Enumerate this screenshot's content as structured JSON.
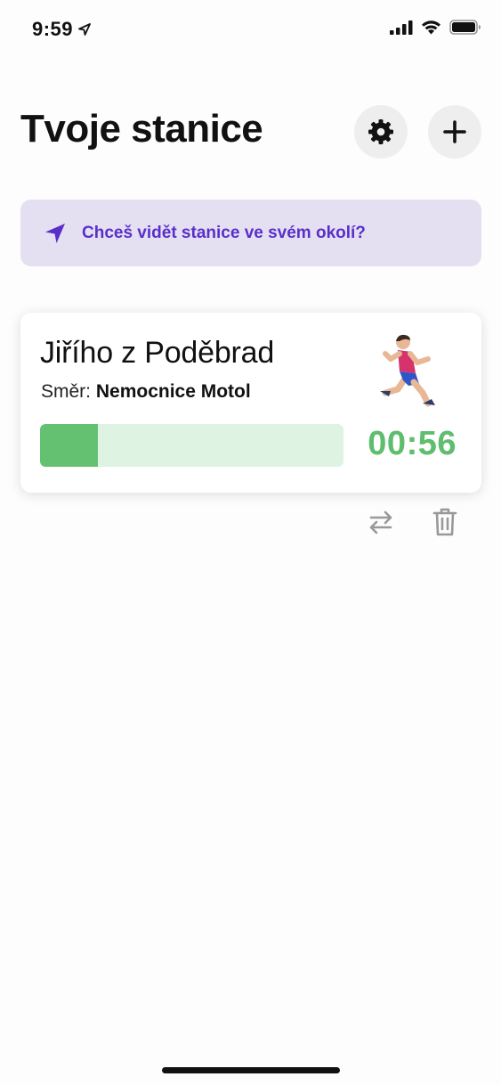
{
  "status_bar": {
    "time": "9:59",
    "icons": [
      "location-arrow-icon",
      "cellular-signal-icon",
      "wifi-icon",
      "battery-icon"
    ]
  },
  "header": {
    "title": "Tvoje stanice",
    "buttons": [
      "gear-icon",
      "plus-icon"
    ]
  },
  "location_banner": {
    "icon": "location-arrow-icon",
    "text": "Chceš vidět stanice ve svém okolí?"
  },
  "station": {
    "name": "Jiřího z Poděbrad",
    "direction_label": "Směr:",
    "direction_value": "Nemocnice Motol",
    "icon": "running-person-icon",
    "progress_fraction": 0.19,
    "countdown": "00:56"
  },
  "card_actions": [
    "swap-arrows-icon",
    "trash-icon"
  ],
  "colors": {
    "accent_purple": "#5a2fc9",
    "banner_bg": "#e4e0f2",
    "progress_fill": "#64c172",
    "progress_track": "#dff3e3",
    "countdown_green": "#5fbd6e"
  }
}
